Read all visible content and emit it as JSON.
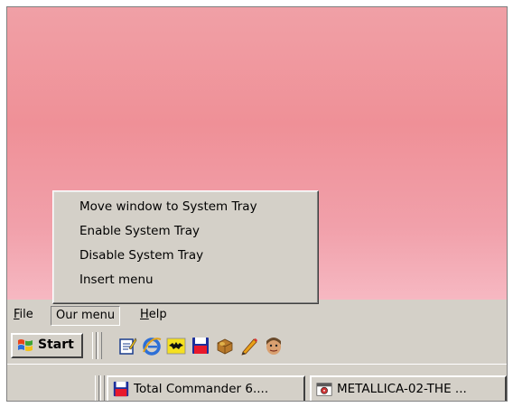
{
  "menubar": {
    "items": [
      {
        "label": "File",
        "mnemonic": "F",
        "rest": "ile"
      },
      {
        "label": "Our menu",
        "mnemonic": "",
        "rest": "Our menu"
      },
      {
        "label": "Help",
        "mnemonic": "H",
        "rest": "elp"
      }
    ],
    "open_item": "Our menu"
  },
  "popup_menu": {
    "items": [
      "Move window to System Tray",
      "Enable System Tray",
      "Disable System Tray",
      "Insert menu"
    ]
  },
  "start": {
    "label": "Start",
    "icon": "windows-flag-icon"
  },
  "quick_launch": [
    {
      "icon": "notepad-icon"
    },
    {
      "icon": "internet-explorer-icon"
    },
    {
      "icon": "bat-icon"
    },
    {
      "icon": "floppy-disk-icon"
    },
    {
      "icon": "package-icon"
    },
    {
      "icon": "pencil-icon"
    },
    {
      "icon": "face-icon"
    }
  ],
  "taskbar": {
    "tasks": [
      {
        "label": "Total Commander 6....",
        "icon": "floppy-disk-icon"
      },
      {
        "label": "METALLICA-02-THE ...",
        "icon": "media-icon"
      }
    ]
  },
  "colors": {
    "desktop_top": "#f0a0a6",
    "desktop_bottom": "#f6b8c2",
    "chrome": "#d4d0c8"
  }
}
